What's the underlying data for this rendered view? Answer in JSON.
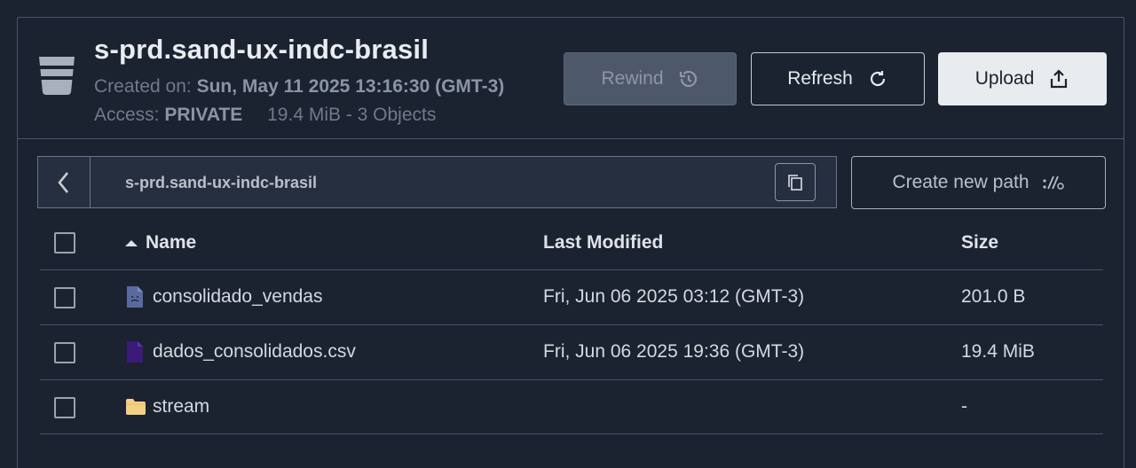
{
  "bucket": {
    "title": "s-prd.sand-ux-indc-brasil",
    "created_label": "Created on:",
    "created_value": "Sun, May 11 2025 13:16:30 (GMT-3)",
    "access_label": "Access:",
    "access_value": "PRIVATE",
    "summary": "19.4 MiB - 3 Objects"
  },
  "actions": {
    "rewind_label": "Rewind",
    "refresh_label": "Refresh",
    "upload_label": "Upload"
  },
  "browser": {
    "path": "s-prd.sand-ux-indc-brasil",
    "new_path_label": "Create new path"
  },
  "table": {
    "columns": {
      "name": "Name",
      "modified": "Last Modified",
      "size": "Size"
    },
    "sort": "name-ascending",
    "rows": [
      {
        "name": "consolidado_vendas",
        "modified": "Fri, Jun 06 2025 03:12 (GMT-3)",
        "size": "201.0 B",
        "icon": "file-icon"
      },
      {
        "name": "dados_consolidados.csv",
        "modified": "Fri, Jun 06 2025 19:36 (GMT-3)",
        "size": "19.4 MiB",
        "icon": "csv-file-icon"
      },
      {
        "name": "stream",
        "modified": "",
        "size": "-",
        "icon": "folder-icon"
      }
    ]
  },
  "colors": {
    "background": "#1b2230",
    "border": "#4a5566",
    "upload_bg": "#e8ecee",
    "file_icon": "#5a6aa0",
    "csv_icon": "#3b1a7a",
    "folder_icon": "#f2d184"
  }
}
